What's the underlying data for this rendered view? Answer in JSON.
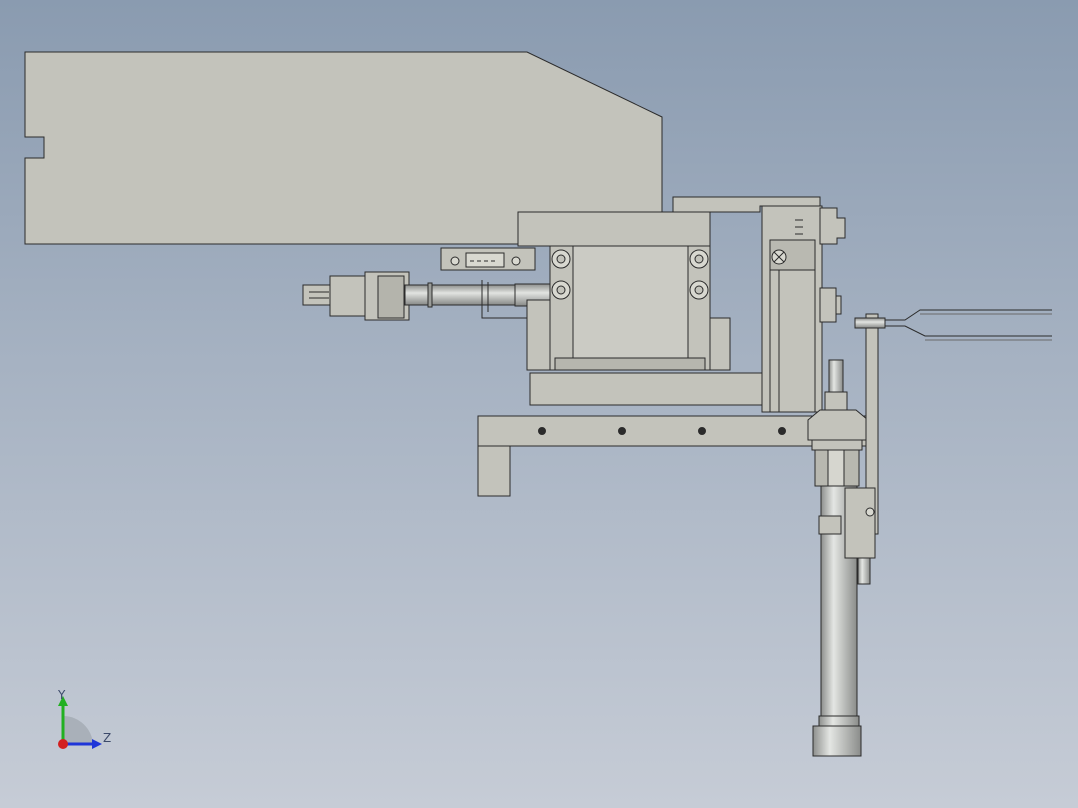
{
  "viewport": {
    "background_top": "#8a9bb0",
    "background_bottom": "#c6ccd6"
  },
  "model": {
    "part_fill": "#c3c3bb",
    "shadow_fill": "#a9a9a2",
    "edge_color": "#2b2b2b",
    "metal_fill": "#b9bbb8"
  },
  "triad": {
    "y_label": "Y",
    "z_label": "Z",
    "y_color": "#21b021",
    "z_color": "#1f35d8",
    "x_color": "#d21f1f"
  }
}
